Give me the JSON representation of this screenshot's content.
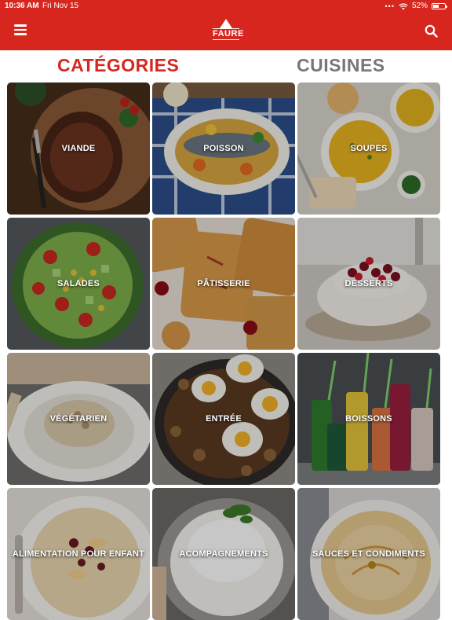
{
  "status_bar": {
    "time": "10:36 AM",
    "date": "Fri Nov 15",
    "battery": "52%",
    "battery_level": 0.52
  },
  "header": {
    "logo_text": "FAURE",
    "menu_icon": "hamburger-menu-icon",
    "search_icon": "search-icon",
    "brand_color": "#d7261e"
  },
  "tabs": {
    "active": "CATÉGORIES",
    "inactive": "CUISINES"
  },
  "categories": [
    {
      "label": "VIANDE"
    },
    {
      "label": "POISSON"
    },
    {
      "label": "SOUPES"
    },
    {
      "label": "SALADES"
    },
    {
      "label": "PÂTISSERIE"
    },
    {
      "label": "DESSERTS"
    },
    {
      "label": "VÉGÉTARIEN"
    },
    {
      "label": "ENTRÉE"
    },
    {
      "label": "BOISSONS"
    },
    {
      "label": "ALIMENTATION POUR ENFANT"
    },
    {
      "label": "ACOMPAGNEMENTS"
    },
    {
      "label": "SAUCES ET CONDIMENTS"
    }
  ]
}
